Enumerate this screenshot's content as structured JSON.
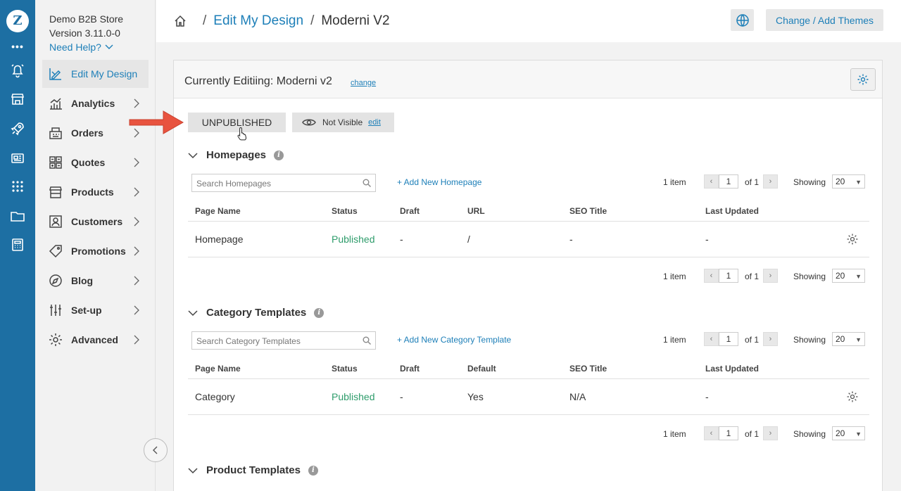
{
  "app": {
    "logo_letter": "Z",
    "rail_more": "•••",
    "rail_icons": [
      "bell-icon",
      "store-icon",
      "rocket-icon",
      "newspaper-icon",
      "grid-icon",
      "folder-icon",
      "calculator-icon"
    ]
  },
  "store": {
    "name": "Demo B2B Store",
    "version": "Version 3.11.0-0",
    "help": "Need Help?"
  },
  "nav": {
    "items": [
      {
        "label": "Edit My Design",
        "icon": "design-icon",
        "active": true
      },
      {
        "label": "Analytics",
        "icon": "analytics-icon"
      },
      {
        "label": "Orders",
        "icon": "orders-icon"
      },
      {
        "label": "Quotes",
        "icon": "quotes-icon"
      },
      {
        "label": "Products",
        "icon": "products-icon"
      },
      {
        "label": "Customers",
        "icon": "customers-icon"
      },
      {
        "label": "Promotions",
        "icon": "promotions-icon"
      },
      {
        "label": "Blog",
        "icon": "blog-icon"
      },
      {
        "label": "Set-up",
        "icon": "setup-icon"
      },
      {
        "label": "Advanced",
        "icon": "advanced-icon"
      }
    ]
  },
  "header": {
    "breadcrumb_sep": "/",
    "breadcrumb_link": "Edit My Design",
    "breadcrumb_current": "Moderni V2",
    "theme_button": "Change / Add Themes"
  },
  "card": {
    "title": "Currently Editiing: Moderni v2",
    "change_link": "change",
    "status_button": "UNPUBLISHED",
    "visibility": "Not Visible",
    "visibility_edit": "edit"
  },
  "sections": {
    "homepages": {
      "title": "Homepages",
      "search_placeholder": "Search Homepages",
      "add_link": "+ Add New Homepage",
      "columns": [
        "Page Name",
        "Status",
        "Draft",
        "URL",
        "SEO Title",
        "Last Updated"
      ],
      "rows": [
        {
          "page_name": "Homepage",
          "status": "Published",
          "draft": "-",
          "col4": "/",
          "seo_title": "-",
          "last_updated": "-"
        }
      ]
    },
    "category": {
      "title": "Category Templates",
      "search_placeholder": "Search Category Templates",
      "add_link": "+ Add New Category Template",
      "columns": [
        "Page Name",
        "Status",
        "Draft",
        "Default",
        "SEO Title",
        "Last Updated"
      ],
      "rows": [
        {
          "page_name": "Category",
          "status": "Published",
          "draft": "-",
          "col4": "Yes",
          "seo_title": "N/A",
          "last_updated": "-"
        }
      ]
    },
    "product": {
      "title": "Product Templates"
    }
  },
  "pager": {
    "count": "1 item",
    "page": "1",
    "of": "of 1",
    "showing": "Showing",
    "per_page": "20"
  },
  "colors": {
    "rail": "#1d6fa3",
    "link": "#1d7fb8",
    "published": "#2e9c6b",
    "arrow": "#e8533f"
  }
}
